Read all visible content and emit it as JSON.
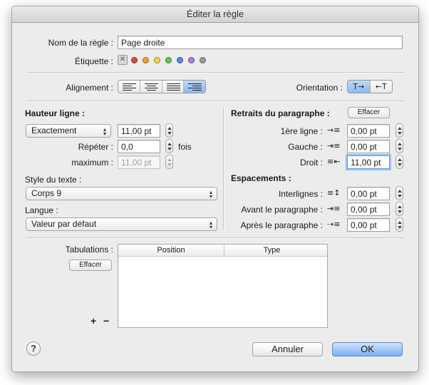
{
  "window": {
    "title": "Éditer la règle"
  },
  "rule_name": {
    "label": "Nom de la règle :",
    "value": "Page droite"
  },
  "tag": {
    "label": "Étiquette :",
    "none_glyph": "✕",
    "colors": [
      "#e6463c",
      "#f0a030",
      "#f0d630",
      "#5fc64a",
      "#4a8ff0",
      "#b27ad6",
      "#9a9a9a"
    ]
  },
  "alignment": {
    "label": "Alignement :",
    "options": [
      "left",
      "center",
      "justify",
      "right"
    ],
    "selected": "right"
  },
  "orientation": {
    "label": "Orientation :",
    "options": [
      "T→",
      "←T"
    ],
    "selected": "T→"
  },
  "line_height": {
    "heading": "Hauteur ligne :",
    "mode": "Exactement",
    "value": "11,00 pt",
    "repeat_label": "Répéter :",
    "repeat_value": "0,0",
    "repeat_unit": "fois",
    "max_label": "maximum :",
    "max_value": "11,00 pt"
  },
  "text_style": {
    "label": "Style du texte :",
    "value": "Corps 9"
  },
  "language": {
    "label": "Langue :",
    "value": "Valeur par défaut"
  },
  "indents": {
    "heading": "Retraits du paragraphe :",
    "clear_label": "Effacer",
    "first_line": {
      "label": "1ère ligne :",
      "value": "0,00 pt"
    },
    "left": {
      "label": "Gauche :",
      "value": "0,00 pt"
    },
    "right": {
      "label": "Droit :",
      "value": "11,00 pt"
    }
  },
  "spacing": {
    "heading": "Espacements :",
    "line": {
      "label": "Interlignes :",
      "value": "0,00 pt"
    },
    "before": {
      "label": "Avant le paragraphe :",
      "value": "0,00 pt"
    },
    "after": {
      "label": "Après le paragraphe :",
      "value": "0,00 pt"
    }
  },
  "tabs": {
    "label": "Tabulations :",
    "clear_label": "Effacer",
    "columns": [
      "Position",
      "Type"
    ],
    "add_glyph": "+",
    "remove_glyph": "−"
  },
  "footer": {
    "help_glyph": "?",
    "cancel_label": "Annuler",
    "ok_label": "OK"
  }
}
